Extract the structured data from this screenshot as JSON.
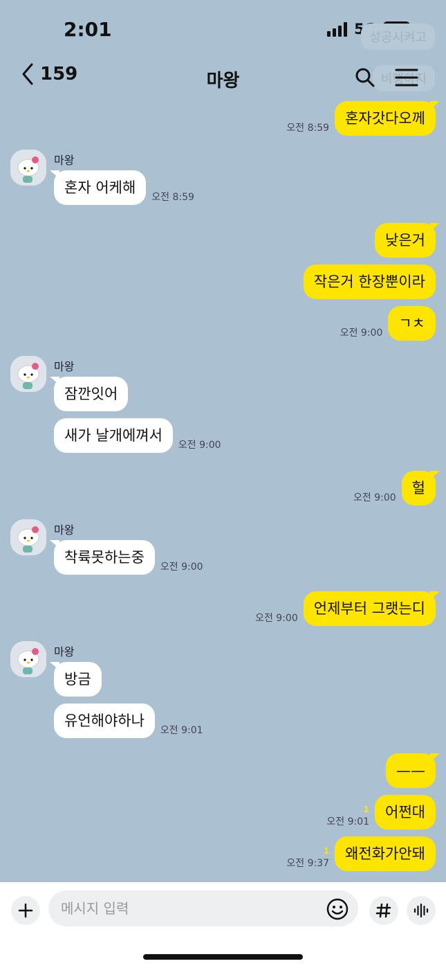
{
  "status": {
    "time": "2:01",
    "network": "5G",
    "battery": "89"
  },
  "header": {
    "back_count": "159",
    "title": "마왕"
  },
  "ghost_texts": [
    "성공시켜고",
    "비행하지"
  ],
  "sender_name": "마왕",
  "messages": [
    {
      "from": "me",
      "text": "혼자갓다오께",
      "time": "오전 8:59"
    },
    {
      "from": "other",
      "text": "혼자 어케해",
      "time": "오전 8:59"
    },
    {
      "from": "me",
      "text": "낮은거"
    },
    {
      "from": "me",
      "text": "작은거 한장뿐이라"
    },
    {
      "from": "me",
      "text": "ㄱㅊ",
      "time": "오전 9:00"
    },
    {
      "from": "other",
      "text": "잠깐잇어"
    },
    {
      "from": "other",
      "text": "새가 날개에껴서",
      "time": "오전 9:00"
    },
    {
      "from": "me",
      "text": "헐",
      "time": "오전 9:00"
    },
    {
      "from": "other",
      "text": "착륙못하는중",
      "time": "오전 9:00"
    },
    {
      "from": "me",
      "text": "언제부터 그랫는디",
      "time": "오전 9:00"
    },
    {
      "from": "other",
      "text": "방금"
    },
    {
      "from": "other",
      "text": "유언해야하나",
      "time": "오전 9:01"
    },
    {
      "from": "me",
      "text": "——"
    },
    {
      "from": "me",
      "text": "어쩐대",
      "time": "오전 9:01",
      "unread": "1"
    },
    {
      "from": "me",
      "text": "왜전화가안돼",
      "time": "오전 9:37",
      "unread": "1"
    }
  ],
  "input": {
    "placeholder": "메시지 입력"
  },
  "colors": {
    "background": "#abc1d1",
    "my_bubble": "#fee500",
    "other_bubble": "#ffffff"
  },
  "icons": [
    "back-chevron-icon",
    "search-icon",
    "menu-icon",
    "plus-icon",
    "emoji-icon",
    "hashtag-icon",
    "voice-icon"
  ]
}
